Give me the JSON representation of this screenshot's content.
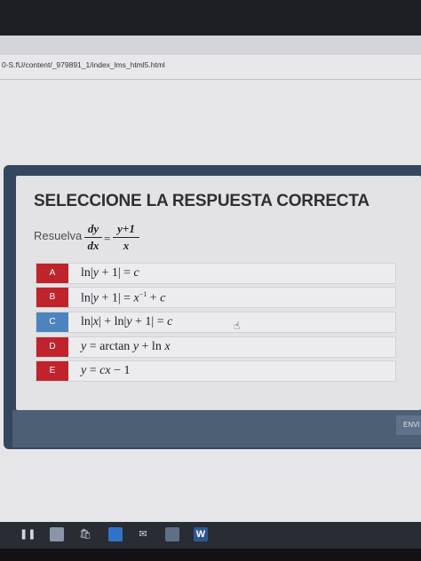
{
  "browser": {
    "url": "0-S.fU/content/_979891_1/index_lms_html5.html"
  },
  "quiz": {
    "title": "SELECCIONE LA RESPUESTA CORRECTA",
    "prompt_label": "Resuelva",
    "equation": {
      "lhs_num": "dy",
      "lhs_den": "dx",
      "equals": "=",
      "rhs_num": "y+1",
      "rhs_den": "x"
    },
    "options": [
      {
        "letter": "A",
        "badge_color": "#c0232b"
      },
      {
        "letter": "B",
        "badge_color": "#c0232b"
      },
      {
        "letter": "C",
        "badge_color": "#4d84bd"
      },
      {
        "letter": "D",
        "badge_color": "#c0232b"
      },
      {
        "letter": "E",
        "badge_color": "#c0232b"
      }
    ],
    "submit_label": "ENVI"
  },
  "taskbar": {
    "icons": [
      "task-view-icon",
      "file-explorer-icon",
      "store-icon",
      "edge-icon",
      "mail-icon",
      "photos-icon",
      "word-icon"
    ]
  }
}
